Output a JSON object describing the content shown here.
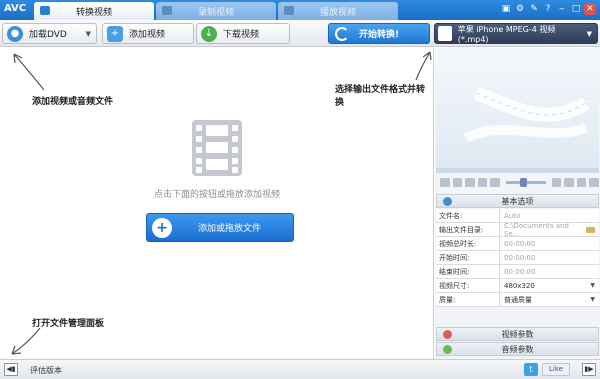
{
  "app": {
    "logo": "AVC"
  },
  "tabs": [
    {
      "label": "转换视频",
      "active": true
    },
    {
      "label": "录制视频",
      "active": false
    },
    {
      "label": "播放视频",
      "active": false
    }
  ],
  "window_controls": [
    "▣",
    "⚙",
    "✎",
    "?",
    "‒",
    "□",
    "✕"
  ],
  "toolbar": {
    "load_dvd": "加载DVD",
    "add_video": "添加视频",
    "download_video": "下载视频",
    "convert": "开始转换!",
    "format": "苹果 iPhone MPEG-4 视频 (*.mp4)"
  },
  "main": {
    "annotation_add": "添加视频或音频文件",
    "annotation_format": "选择输出文件格式并转换",
    "annotation_panel": "打开文件管理面板",
    "hint": "点击下面的按钮或拖放添加视频",
    "add_button": "添加或拖放文件"
  },
  "options": {
    "basic_title": "基本选项",
    "rows": [
      {
        "label": "文件名:",
        "value": "Auto",
        "kind": "text"
      },
      {
        "label": "输出文件目录:",
        "value": "C:\\Documents and Se...",
        "kind": "folder"
      },
      {
        "label": "视频总时长:",
        "value": "00:00:00",
        "kind": "text"
      },
      {
        "label": "开始时间:",
        "value": "00:00:00",
        "kind": "text"
      },
      {
        "label": "结束时间:",
        "value": "00:00:00",
        "kind": "text"
      },
      {
        "label": "视频尺寸:",
        "value": "480x320",
        "kind": "select"
      },
      {
        "label": "质量:",
        "value": "普通质量",
        "kind": "select"
      }
    ],
    "video_params": "视频参数",
    "audio_params": "音频参数"
  },
  "status": {
    "eval": "评估版本",
    "twitter": "t",
    "facebook_like": "Like"
  },
  "colors": {
    "accent": "#1f78d1",
    "titlebar": "#1b6fc4"
  }
}
